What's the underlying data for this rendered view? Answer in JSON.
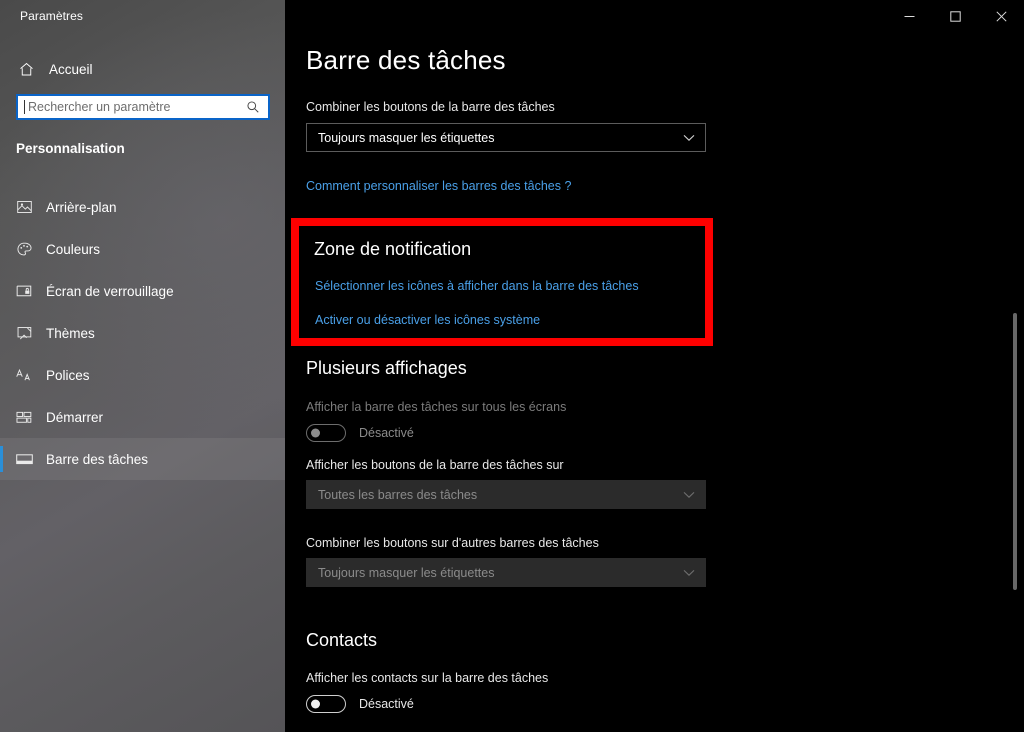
{
  "window": {
    "app_title": "Paramètres",
    "controls": {
      "minimize": "minimize-icon",
      "maximize": "maximize-icon",
      "close": "close-icon"
    }
  },
  "sidebar": {
    "home_label": "Accueil",
    "home_icon": "home-icon",
    "search": {
      "placeholder": "Rechercher un paramètre",
      "value": "",
      "icon": "search-icon"
    },
    "section_title": "Personnalisation",
    "items": [
      {
        "label": "Arrière-plan",
        "icon": "image-icon",
        "selected": false
      },
      {
        "label": "Couleurs",
        "icon": "palette-icon",
        "selected": false
      },
      {
        "label": "Écran de verrouillage",
        "icon": "lockscreen-icon",
        "selected": false
      },
      {
        "label": "Thèmes",
        "icon": "theme-brush-icon",
        "selected": false
      },
      {
        "label": "Polices",
        "icon": "fonts-icon",
        "selected": false
      },
      {
        "label": "Démarrer",
        "icon": "start-tiles-icon",
        "selected": false
      },
      {
        "label": "Barre des tâches",
        "icon": "taskbar-icon",
        "selected": true
      }
    ]
  },
  "main": {
    "page_title": "Barre des tâches",
    "combine_buttons": {
      "label": "Combiner les boutons de la barre des tâches",
      "value": "Toujours masquer les étiquettes",
      "chevron": "chevron-down-icon"
    },
    "help_link": "Comment personnaliser les barres des tâches ?",
    "notification_area": {
      "heading": "Zone de notification",
      "link_select_icons": "Sélectionner les icônes à afficher dans la barre des tâches",
      "link_system_icons": "Activer ou désactiver les icônes système",
      "highlight_color": "#fe0000"
    },
    "multiple_displays": {
      "heading": "Plusieurs affichages",
      "show_taskbar_all_displays": {
        "label": "Afficher la barre des tâches sur tous les écrans",
        "state": "Désactivé"
      },
      "show_buttons_on": {
        "label": "Afficher les boutons de la barre des tâches sur",
        "value": "Toutes les barres des tâches",
        "chevron": "chevron-down-icon"
      },
      "combine_other_taskbars": {
        "label": "Combiner les boutons sur d'autres barres des tâches",
        "value": "Toujours masquer les étiquettes",
        "chevron": "chevron-down-icon"
      }
    },
    "contacts": {
      "heading": "Contacts",
      "show_contacts": {
        "label": "Afficher les contacts sur la barre des tâches",
        "state": "Désactivé"
      }
    }
  },
  "colors": {
    "accent": "#2a8fd8",
    "link": "#4aa0e8",
    "highlight": "#fe0000",
    "sidebar_bg": "#5a595c",
    "content_bg": "#000000"
  }
}
